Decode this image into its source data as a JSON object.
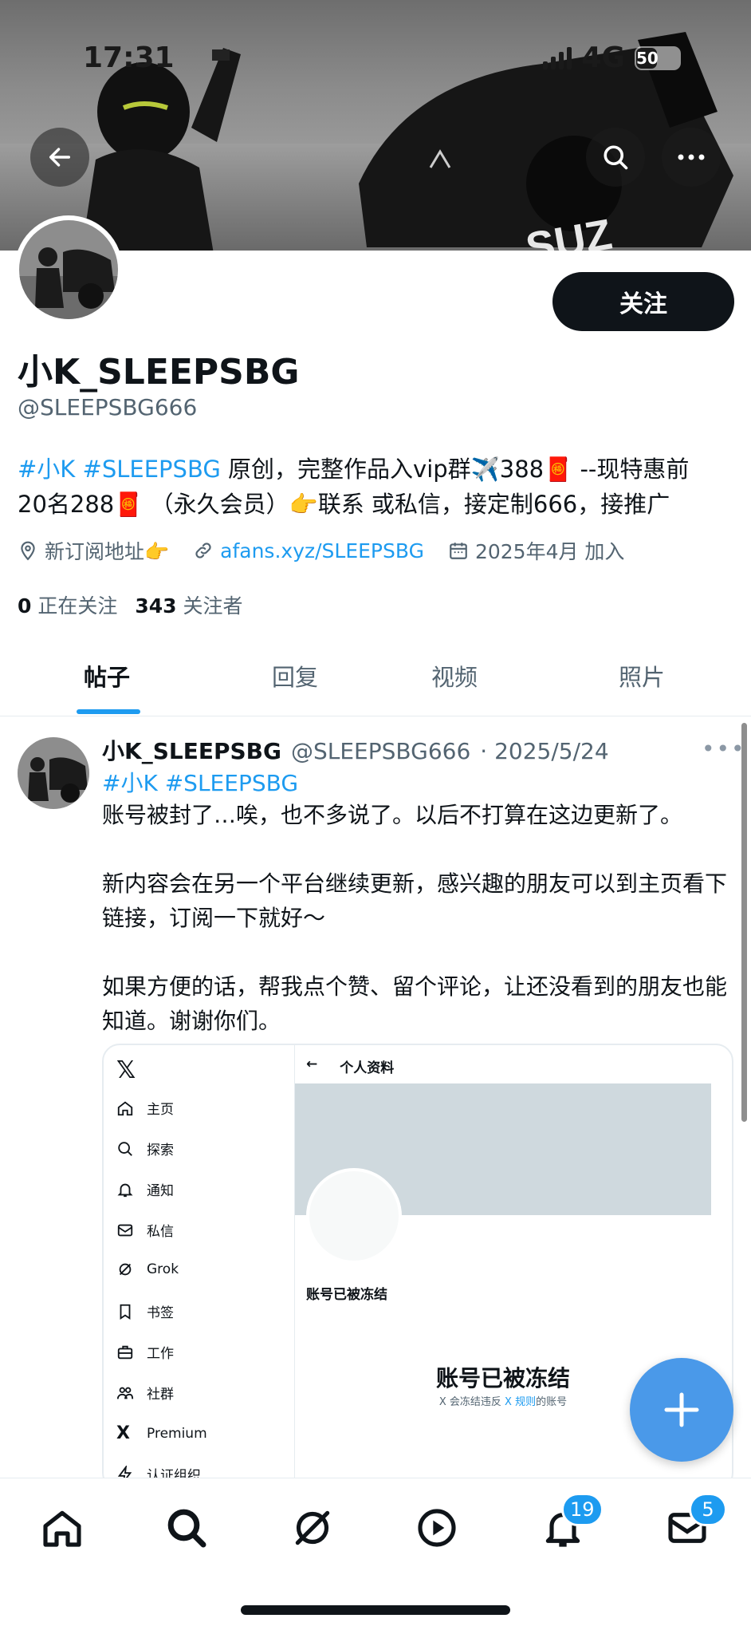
{
  "status_bar": {
    "time": "17:31",
    "network": "4G",
    "battery": "50"
  },
  "profile": {
    "display_name": "小K_SLEEPSBG",
    "handle": "@SLEEPSBG666",
    "follow_label": "关注",
    "bio": {
      "tags": "#小K #SLEEPSBG",
      "text_line1": " 原创，完整作品入vip群✈️388🧧 --现特惠前",
      "text_line2": "20名288🧧 （永久会员）👉联系 或私信，接定制666，接推广"
    },
    "location": "新订阅地址👉",
    "website": "afans.xyz/SLEEPSBG",
    "joined": "2025年4月 加入",
    "following_count": "0",
    "following_label": "正在关注",
    "followers_count": "343",
    "followers_label": "关注者"
  },
  "tabs": [
    "帖子",
    "回复",
    "视频",
    "照片"
  ],
  "post": {
    "name": "小K_SLEEPSBG",
    "handle": "@SLEEPSBG666",
    "date": "· 2025/5/24",
    "more": "•••",
    "tags": "#小K #SLEEPSBG",
    "para1": "账号被封了…唉，也不多说了。以后不打算在这边更新了。",
    "para2": "新内容会在另一个平台继续更新，感兴趣的朋友可以到主页看下链接，订阅一下就好～",
    "para3": "如果方便的话，帮我点个赞、留个评论，让还没看到的朋友也能知道。谢谢你们。"
  },
  "embed": {
    "logo": "𝕏",
    "nav": [
      "主页",
      "探索",
      "通知",
      "私信",
      "Grok",
      "书签",
      "工作",
      "社群",
      "Premium",
      "认证组织"
    ],
    "back": "←",
    "topbar_title": "个人资料",
    "frozen_label": "账号已被冻结",
    "big_title": "账号已被冻结",
    "sub_pre": "X 会冻结违反 ",
    "sub_link": "X 规则",
    "sub_post": "的账号"
  },
  "bottom_nav": {
    "notifications_badge": "19",
    "messages_badge": "5"
  },
  "colors": {
    "accent": "#1d9bf0",
    "fab": "#4a99e9",
    "text": "#0f1419",
    "muted": "#536471"
  }
}
